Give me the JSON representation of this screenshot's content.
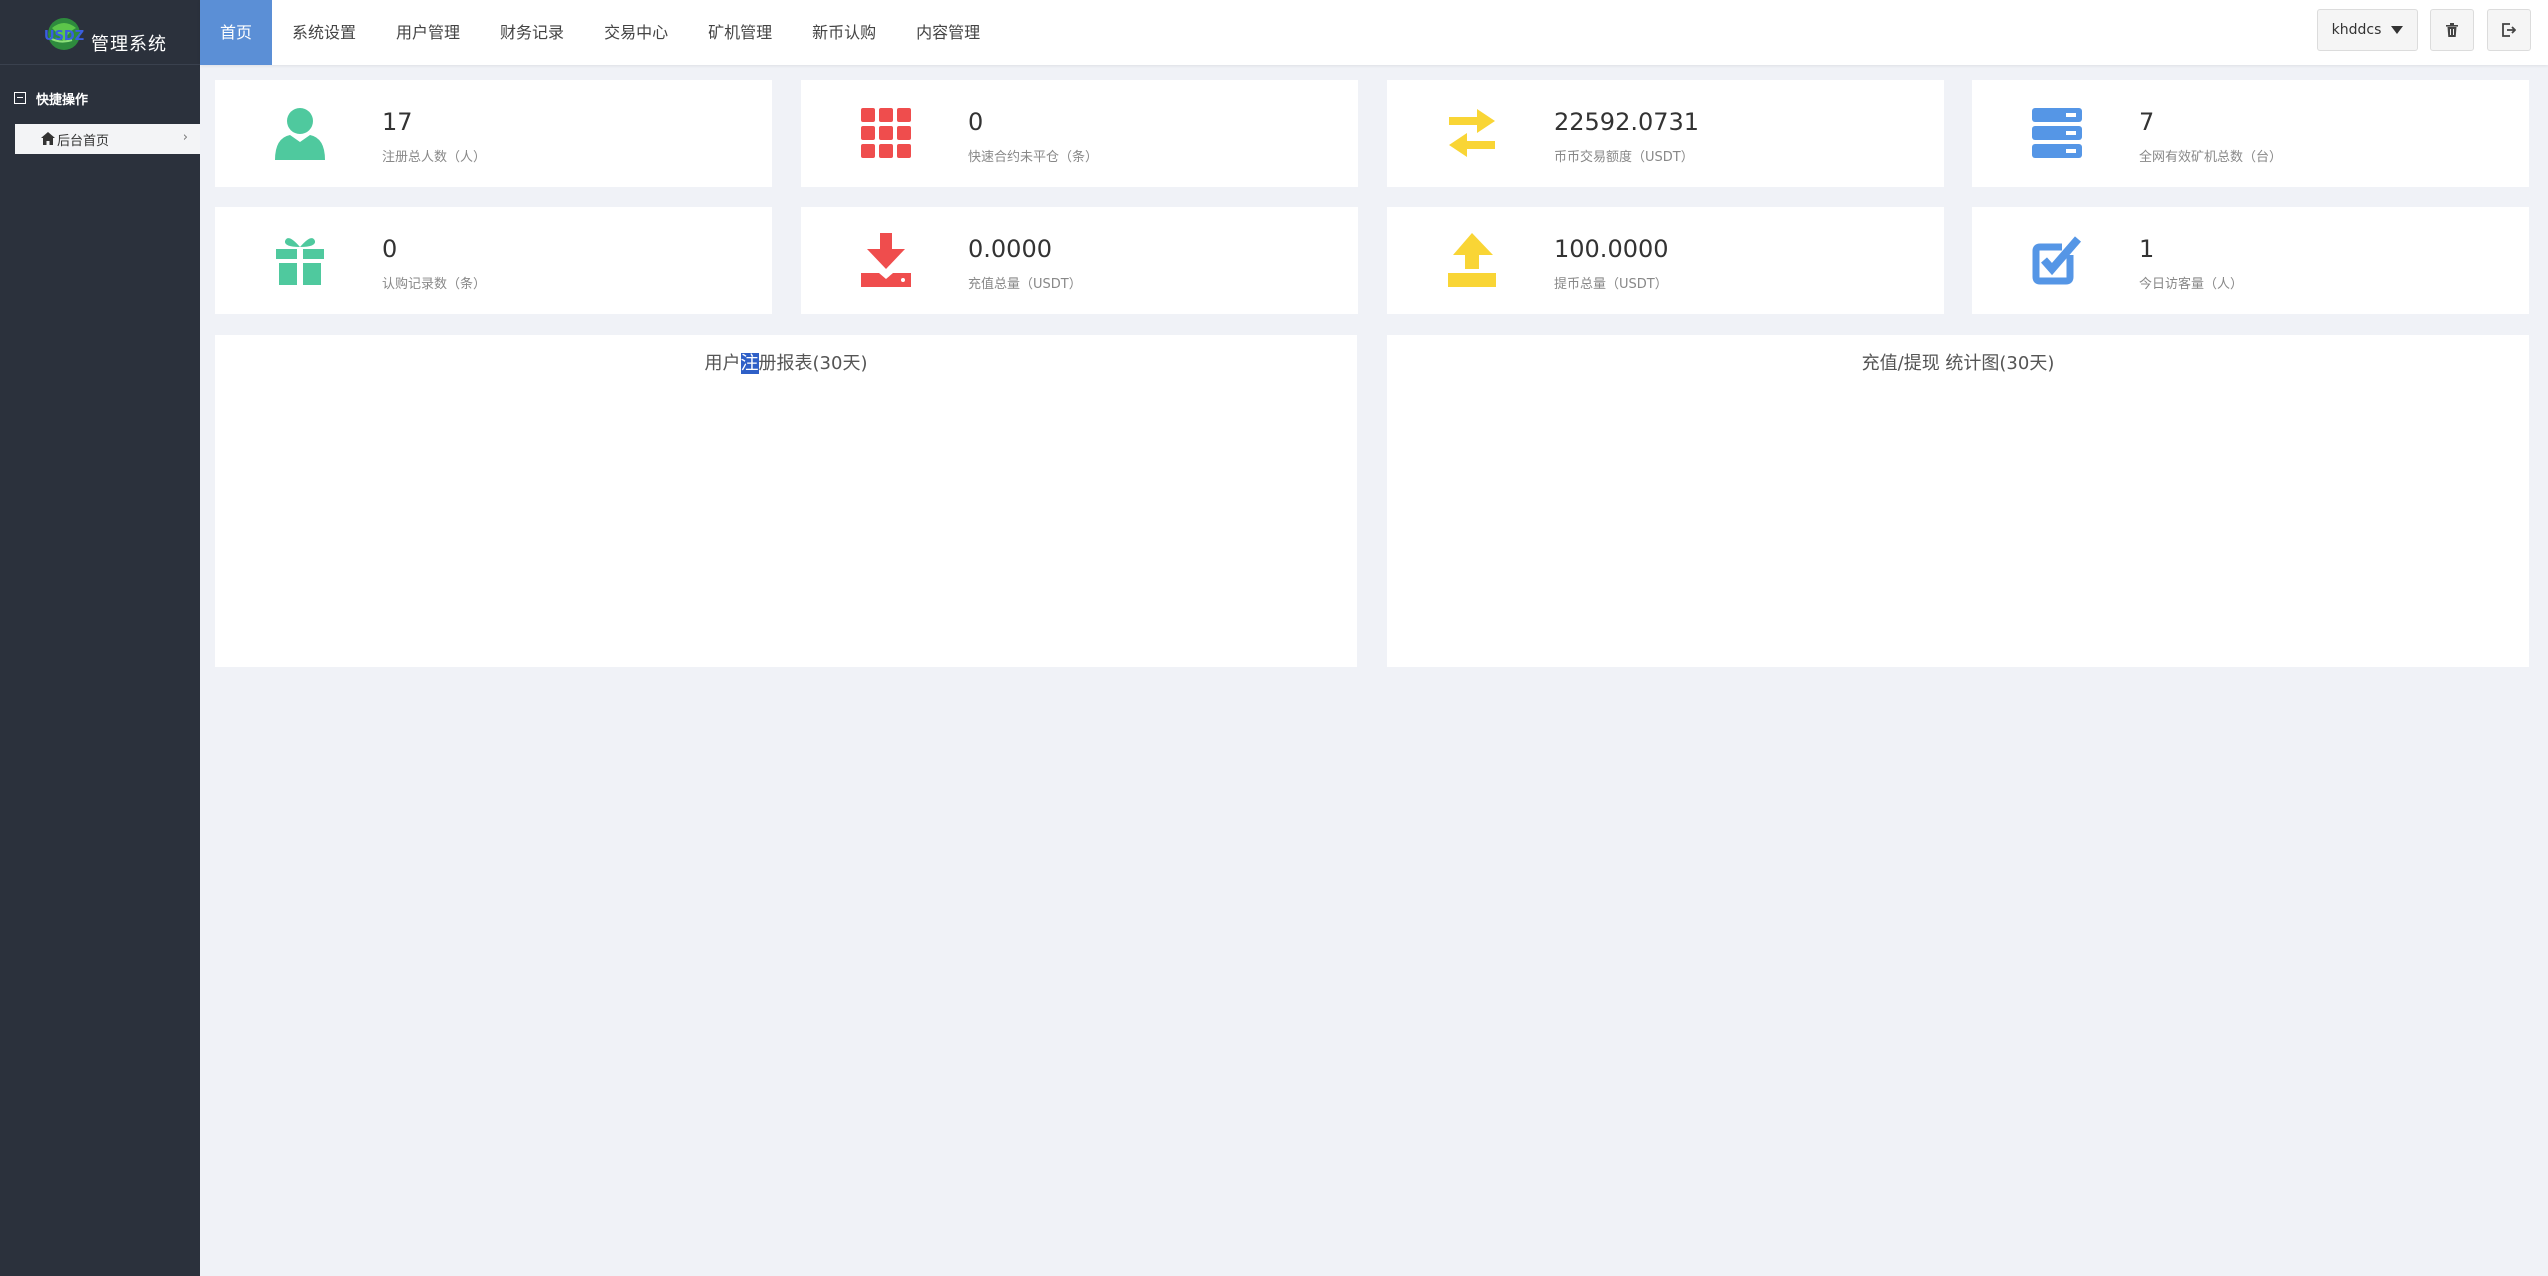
{
  "brand": {
    "logo_text": "USDZ",
    "title": "管理系统"
  },
  "sidebar": {
    "section_title": "快捷操作",
    "items": [
      {
        "label": "后台首页",
        "icon": "home-icon",
        "chevron": "›"
      }
    ]
  },
  "nav": {
    "items": [
      {
        "label": "首页",
        "active": true
      },
      {
        "label": "系统设置"
      },
      {
        "label": "用户管理"
      },
      {
        "label": "财务记录"
      },
      {
        "label": "交易中心"
      },
      {
        "label": "矿机管理"
      },
      {
        "label": "新币认购"
      },
      {
        "label": "内容管理"
      }
    ],
    "active_color": "#5b8fd6"
  },
  "header_actions": {
    "username": "khddcs",
    "clear_cache_icon": "trash-icon",
    "logout_icon": "logout-icon"
  },
  "stats": [
    {
      "value": "17",
      "label": "注册总人数（人）",
      "icon": "user-icon",
      "color": "#4fc99e"
    },
    {
      "value": "0",
      "label": "快速合约未平仓（条）",
      "icon": "grid-icon",
      "color": "#ef4d4d"
    },
    {
      "value": "22592.0731",
      "label": "币币交易额度（USDT）",
      "icon": "exchange-icon",
      "color": "#f9d535"
    },
    {
      "value": "7",
      "label": "全网有效矿机总数（台）",
      "icon": "server-icon",
      "color": "#5596e6"
    },
    {
      "value": "0",
      "label": "认购记录数（条）",
      "icon": "gift-icon",
      "color": "#4fc99e"
    },
    {
      "value": "0.0000",
      "label": "充值总量（USDT）",
      "icon": "download-icon",
      "color": "#ef4d4d"
    },
    {
      "value": "100.0000",
      "label": "提币总量（USDT）",
      "icon": "upload-icon",
      "color": "#f9d535"
    },
    {
      "value": "1",
      "label": "今日访客量（人）",
      "icon": "check-square-icon",
      "color": "#5596e6"
    }
  ],
  "charts": {
    "registration": {
      "title_pre": "用户",
      "title_hl": "注",
      "title_post": "册报表(30天)"
    },
    "recharge": {
      "title": "充值/提现 统计图(30天)"
    }
  }
}
